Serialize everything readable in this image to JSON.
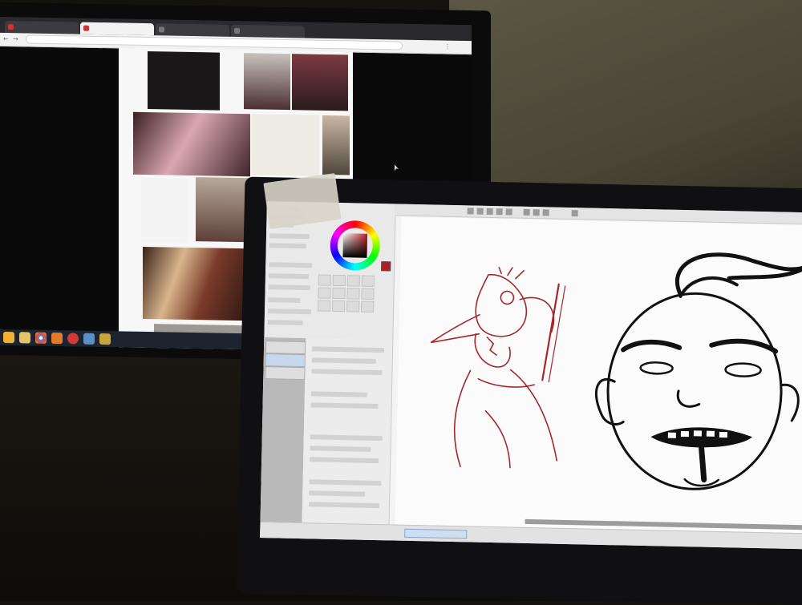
{
  "scene": {
    "description_free": true
  },
  "browser": {
    "tabs": [
      {
        "label": ""
      },
      {
        "label": ""
      },
      {
        "label": ""
      },
      {
        "label": ""
      }
    ],
    "address": ""
  },
  "paint_app": {
    "foreground_color": "#b11d24",
    "document_tab": "",
    "sketch_stroke_red": "#a3272b",
    "sketch_stroke_black": "#111111"
  },
  "icons": {
    "cursor": "mouse-cursor-icon",
    "wheel": "color-wheel-icon"
  }
}
